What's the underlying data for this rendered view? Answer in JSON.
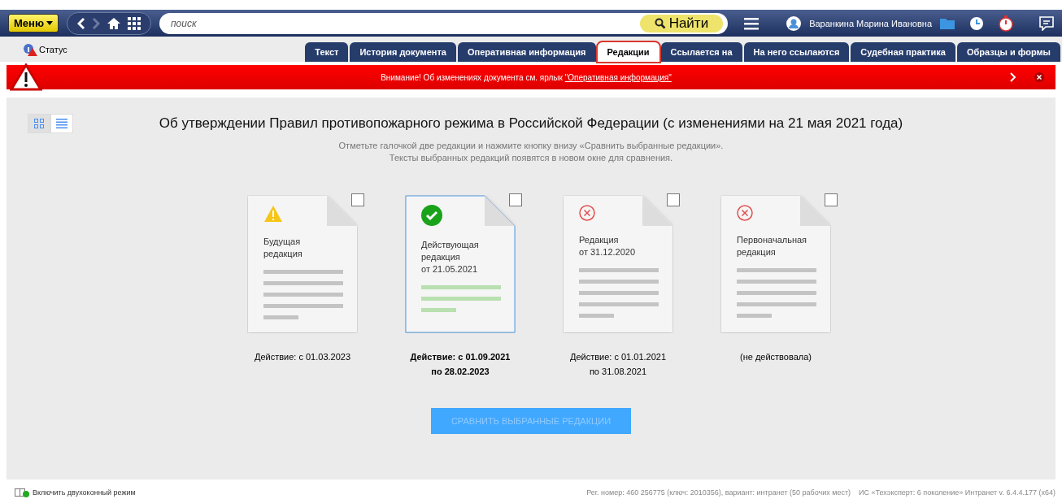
{
  "topbar": {
    "menu": "Меню",
    "search": {
      "placeholder": "поиск"
    },
    "find": "Найти",
    "user": "Варанкина Марина Ивановна"
  },
  "status": "Статус",
  "tabs": [
    {
      "label": "Текст",
      "selected": false
    },
    {
      "label": "История документа",
      "selected": false
    },
    {
      "label": "Оперативная информация",
      "selected": false
    },
    {
      "label": "Редакции",
      "selected": true
    },
    {
      "label": "Ссылается на",
      "selected": false
    },
    {
      "label": "На него ссылаются",
      "selected": false
    },
    {
      "label": "Судебная практика",
      "selected": false
    },
    {
      "label": "Образцы и формы",
      "selected": false
    }
  ],
  "alert": {
    "text": "Внимание! Об изменениях документа см. ярлык ",
    "link": "\"Оперативная информация\""
  },
  "view_toggle": [
    {
      "kind": "grid",
      "selected": true
    },
    {
      "kind": "list",
      "selected": false
    }
  ],
  "title": "Об утверждении Правил противопожарного режима в Российской Федерации (с изменениями на 21 мая 2021 года)",
  "hint": [
    "Отметьте галочкой две редакции и нажмите кнопку внизу «Сравнить выбранные редакции».",
    "Тексты выбранных редакций появятся в новом окне для сравнения."
  ],
  "editions": [
    {
      "kind": "future",
      "current": false,
      "checked": false,
      "name": [
        "Будущая",
        "редакция"
      ],
      "period": [
        "Действие: с 01.03.2023"
      ]
    },
    {
      "kind": "current",
      "current": true,
      "checked": false,
      "name": [
        "Действующая",
        "редакция",
        "от 21.05.2021"
      ],
      "period": [
        "Действие: с 01.09.2021",
        "по 28.02.2023"
      ]
    },
    {
      "kind": "expired",
      "current": false,
      "checked": false,
      "name": [
        "Редакция",
        "от 31.12.2020"
      ],
      "period": [
        "Действие: с 01.01.2021",
        "по 31.08.2021"
      ]
    },
    {
      "kind": "expired",
      "current": false,
      "checked": false,
      "name": [
        "Первоначальная",
        "редакция"
      ],
      "period": [
        "(не действовала)"
      ]
    }
  ],
  "compare_button": {
    "label": "СРАВНИТЬ ВЫБРАННЫЕ РЕДАКЦИИ",
    "disabled": true
  },
  "footer": {
    "two_window": "Включить двухоконный режим",
    "reg": "Рег. номер: 460  256775 (ключ: 2010356), вариант: интранет (50 рабочих мест)",
    "version": "ИС «Техэксперт: 6 поколение» Интранет v. 6.4.4.177 (x64)"
  }
}
